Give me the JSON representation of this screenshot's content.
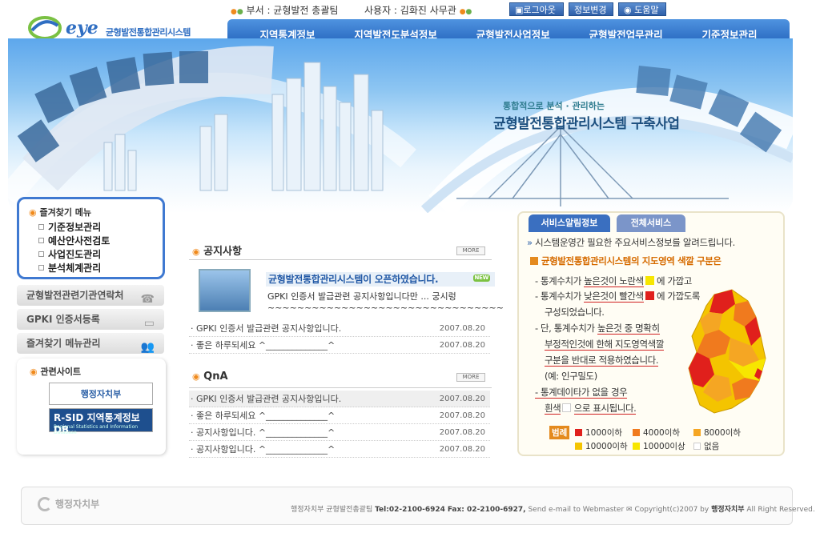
{
  "top": {
    "dept_label": "부서 : 균형발전 총괄팀",
    "user_label": "사용자 : 김화진 사무관",
    "logout": "로그아웃",
    "info_change": "정보변경",
    "help": "도움말"
  },
  "logo": {
    "eye": "eye",
    "system": "균형발전통합관리시스템"
  },
  "nav": [
    "지역통계정보",
    "지역발전도분석정보",
    "균형발전사업정보",
    "균형발전업무관리",
    "기준정보관리"
  ],
  "hero": {
    "subtitle": "통합적으로 분석 · 관리하는",
    "title": "균형발전통합관리시스템 구축사업"
  },
  "favorites": {
    "title": "즐겨찾기 메뉴",
    "items": [
      "기준정보관리",
      "예산안사전검토",
      "사업진도관리",
      "분석체계관리"
    ]
  },
  "left_buttons": [
    "균형발전관련기관연락처",
    "GPKI 인증서등록",
    "즐겨찾기 메뉴관리"
  ],
  "related": {
    "title": "관련사이트",
    "site1": "행정자치부",
    "site2_big": "R-SID 지역통계정보DB",
    "site2_small": "Regional Statistics and Information Database"
  },
  "notice": {
    "title": "공지사항",
    "more": "MORE",
    "headline": "균형발전통합관리시스템이 오픈하였습니다.",
    "new_badge": "NEW",
    "body": "GPKI 인증서 발급관련 공지사항입니다만 ... 궁시렁~~~~~~~~~~~~~~~~~~~~~~~~~~~~~~~~",
    "rows": [
      {
        "title": "· GPKI 인증서 발급관련 공지사항입니다.",
        "date": "2007.08.20"
      },
      {
        "title": "· 좋은 하루되세요 ^______________^",
        "date": "2007.08.20"
      }
    ]
  },
  "qna": {
    "title": "QnA",
    "more": "MORE",
    "rows": [
      {
        "title": "· GPKI 인증서 발급관련 공지사항입니다.",
        "date": "2007.08.20"
      },
      {
        "title": "· 좋은 하루되세요 ^______________^",
        "date": "2007.08.20"
      },
      {
        "title": "· 공지사항입니다. ^______________^",
        "date": "2007.08.20"
      },
      {
        "title": "· 공지사항입니다. ^______________^",
        "date": "2007.08.20"
      }
    ]
  },
  "service": {
    "tab1": "서비스알림정보",
    "tab2": "전체서비스",
    "intro": "시스템운영간 필요한 주요서비스정보를 알려드립니다.",
    "heading": "균형발전통합관리시스템의 지도영역 색깔 구분은",
    "line1a": "- 통계수치가",
    "line1b": "높은것이 노란색",
    "line1c": "에 가깝고",
    "line2a": "- 통계수치가",
    "line2b": "낮은것이 빨간색",
    "line2c": "에 가깝도록",
    "line3": "구성되었습니다.",
    "line4a": "- 단, 통계수치가",
    "line4b": "높은것 중 명확히",
    "line5": "부정적인것에 한해 지도영역색깔",
    "line6a": "구분을 반대로 적용하였습니다.",
    "line7": "(예: 인구밀도)",
    "line8": "- 통계데이타가 없을 경우",
    "line9a": "흰색",
    "line9b": "으로 표시됩니다.",
    "legend_label": "범례",
    "legend": [
      {
        "label": "1000이하",
        "color": "#e0201c"
      },
      {
        "label": "4000이하",
        "color": "#f07a1e"
      },
      {
        "label": "8000이하",
        "color": "#f5a623"
      },
      {
        "label": "10000이하",
        "color": "#f4c400"
      },
      {
        "label": "10000이상",
        "color": "#f7e600"
      },
      {
        "label": "없음",
        "color": "#ffffff"
      }
    ],
    "yellow": "#f7e600",
    "red": "#e0201c"
  },
  "footer": {
    "logo": "행정자치부",
    "text_pre": "행정자치부 균형발전총괄팀",
    "tel": "Tel:02-2100-6924",
    "fax": "Fax: 02-2100-6927,",
    "email": "Send e-mail to Webmaster",
    "copy": "Copyright(c)2007 by",
    "org": "행정자치부",
    "rights": "All Right Reserved."
  }
}
